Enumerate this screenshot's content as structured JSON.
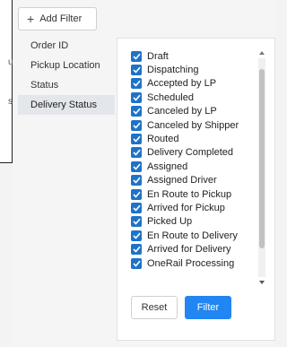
{
  "add_filter_label": "Add Filter",
  "background_fragments": [
    "u",
    "s"
  ],
  "left_menu": [
    {
      "label": "Order ID",
      "active": false
    },
    {
      "label": "Pickup Location",
      "active": false
    },
    {
      "label": "Status",
      "active": false
    },
    {
      "label": "Delivery Status",
      "active": true
    }
  ],
  "statuses": [
    {
      "label": "Draft",
      "checked": true
    },
    {
      "label": "Dispatching",
      "checked": true
    },
    {
      "label": "Accepted by LP",
      "checked": true
    },
    {
      "label": "Scheduled",
      "checked": true
    },
    {
      "label": "Canceled by LP",
      "checked": true
    },
    {
      "label": "Canceled by Shipper",
      "checked": true
    },
    {
      "label": "Routed",
      "checked": true
    },
    {
      "label": "Delivery Completed",
      "checked": true
    },
    {
      "label": "Assigned",
      "checked": true
    },
    {
      "label": "Assigned Driver",
      "checked": true
    },
    {
      "label": "En Route to Pickup",
      "checked": true
    },
    {
      "label": "Arrived for Pickup",
      "checked": true
    },
    {
      "label": "Picked Up",
      "checked": true
    },
    {
      "label": "En Route to Delivery",
      "checked": true
    },
    {
      "label": "Arrived for Delivery",
      "checked": true
    },
    {
      "label": "OneRail Processing",
      "checked": true
    }
  ],
  "reset_label": "Reset",
  "filter_label": "Filter",
  "colors": {
    "checkbox": "#1e73c9",
    "primary_button": "#2185f2",
    "active_item_bg": "#e3e6ea"
  },
  "icons": {
    "add": "plus-icon",
    "check": "checkmark-icon",
    "scroll_up": "chevron-up-icon",
    "scroll_down": "chevron-down-icon"
  }
}
